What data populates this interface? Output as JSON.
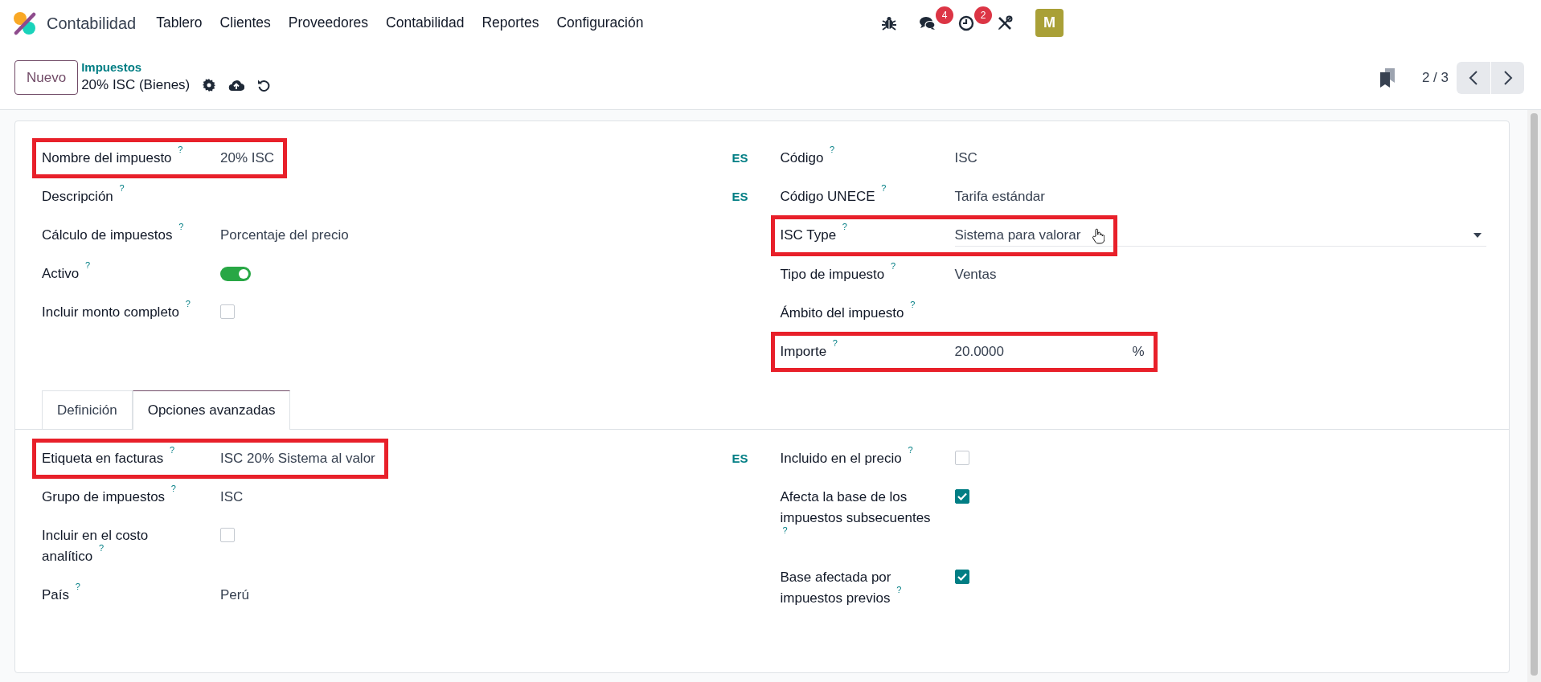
{
  "navbar": {
    "app_name": "Contabilidad",
    "menu": [
      "Tablero",
      "Clientes",
      "Proveedores",
      "Contabilidad",
      "Reportes",
      "Configuración"
    ],
    "systray": [
      {
        "kind": "bug"
      },
      {
        "kind": "chat",
        "badge": "4"
      },
      {
        "kind": "clock",
        "badge": "2"
      },
      {
        "kind": "tools"
      }
    ],
    "avatar": "M"
  },
  "control_panel": {
    "new_button": "Nuevo",
    "breadcrumb": {
      "parent": "Impuestos",
      "current": "20% ISC (Bienes)"
    },
    "pager": "2 / 3"
  },
  "form": {
    "left": [
      {
        "label": "Nombre del impuesto",
        "hint": "?",
        "kind": "text",
        "value": "20% ISC",
        "lang": "ES",
        "highlighted": true
      },
      {
        "label": "Descripción",
        "hint": "?",
        "kind": "text",
        "lang": "ES",
        "highlighted": false
      },
      {
        "label": "Cálculo de impuestos",
        "hint": "?",
        "kind": "text",
        "value": "Porcentaje del precio",
        "highlighted": false
      },
      {
        "label": "Activo",
        "hint": "?",
        "kind": "toggle",
        "on": true,
        "highlighted": false
      },
      {
        "label": "Incluir monto completo",
        "hint": "?",
        "kind": "checkbox",
        "checked": false,
        "highlighted": false
      }
    ],
    "right": [
      {
        "label": "Código",
        "hint": "?",
        "kind": "text",
        "value": "ISC",
        "highlighted": false
      },
      {
        "label": "Código UNECE",
        "hint": "?",
        "kind": "text",
        "value": "Tarifa estándar",
        "highlighted": false
      },
      {
        "label": "ISC Type",
        "hint": "?",
        "kind": "select",
        "value": "Sistema para valorar",
        "cursor": true,
        "highlighted": true
      },
      {
        "label": "Tipo de impuesto",
        "hint": "?",
        "kind": "text",
        "value": "Ventas",
        "highlighted": false
      },
      {
        "label": "Ámbito del impuesto",
        "hint": "?",
        "kind": "text",
        "highlighted": false
      },
      {
        "label": "Importe",
        "hint": "?",
        "kind": "number",
        "value": "20.0000",
        "suffix": "%",
        "highlighted": true
      }
    ]
  },
  "tabs": [
    {
      "label": "Definición",
      "selected": false
    },
    {
      "label": "Opciones avanzadas",
      "selected": true
    }
  ],
  "tab_content": {
    "left": [
      {
        "label": "Etiqueta en facturas",
        "hint": "?",
        "kind": "text",
        "value": "ISC 20% Sistema al valor",
        "lang": "ES",
        "highlighted": true
      },
      {
        "label": "Grupo de impuestos",
        "hint": "?",
        "kind": "text",
        "value": "ISC",
        "highlighted": false
      },
      {
        "label": "Incluir en el costo analítico",
        "hint": "?",
        "kind": "checkbox",
        "checked": false,
        "highlighted": false
      },
      {
        "label": "País",
        "hint": "?",
        "kind": "text",
        "value": "Perú",
        "highlighted": false
      }
    ],
    "right": [
      {
        "label": "Incluido en el precio",
        "hint": "?",
        "kind": "checkbox",
        "checked": false,
        "highlighted": false
      },
      {
        "label": "Afecta la base de los impuestos subsecuentes",
        "hint": "?",
        "kind": "checkbox",
        "checked": true,
        "highlighted": false
      },
      {
        "label": "Base afectada por impuestos previos",
        "hint": "?",
        "kind": "checkbox",
        "checked": true,
        "highlighted": false
      }
    ]
  }
}
